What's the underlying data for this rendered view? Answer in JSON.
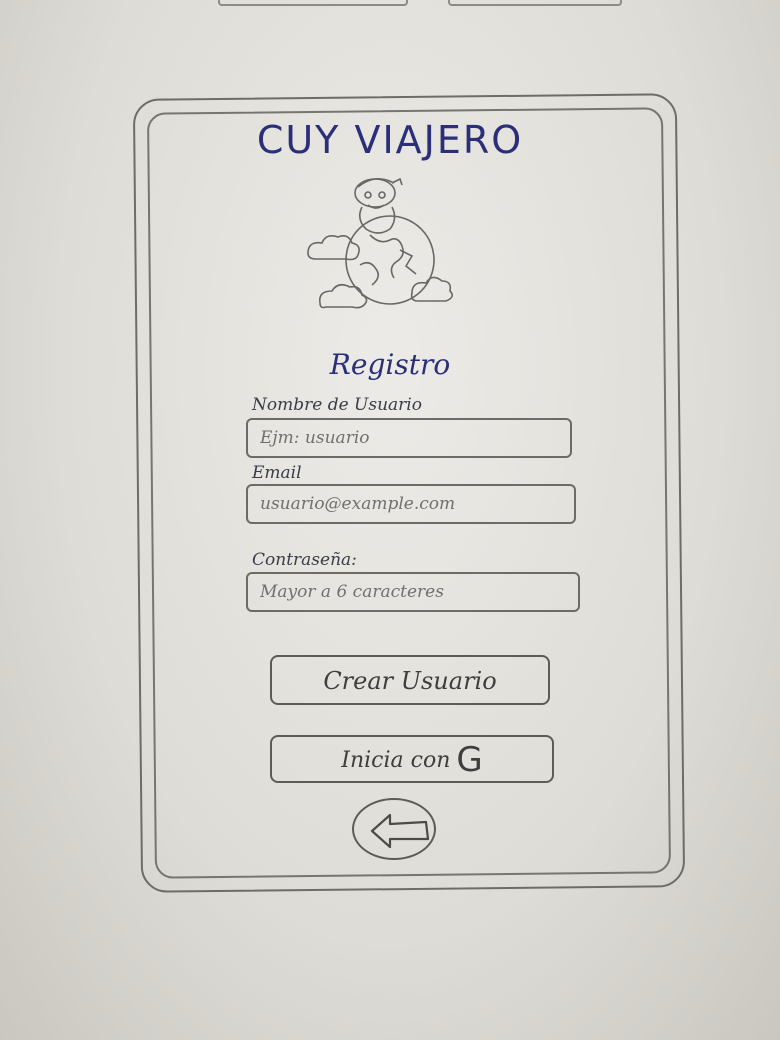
{
  "app": {
    "title": "CUY VIAJERO"
  },
  "form": {
    "heading": "Registro",
    "username": {
      "label": "Nombre de Usuario",
      "placeholder": "Ejm: usuario"
    },
    "email": {
      "label": "Email",
      "placeholder": "usuario@example.com"
    },
    "password": {
      "label": "Contraseña:",
      "placeholder": "Mayor a 6 caracteres"
    }
  },
  "buttons": {
    "create_user": "Crear Usuario",
    "google_signin_prefix": "Inicia con",
    "google_signin_glyph": "G"
  },
  "icons": {
    "logo": "cuy-globe-logo",
    "back": "back-arrow-icon"
  },
  "colors": {
    "ink_blue": "#2b2f7a",
    "pencil": "#6d6b67",
    "paper": "#e6e5e1"
  }
}
